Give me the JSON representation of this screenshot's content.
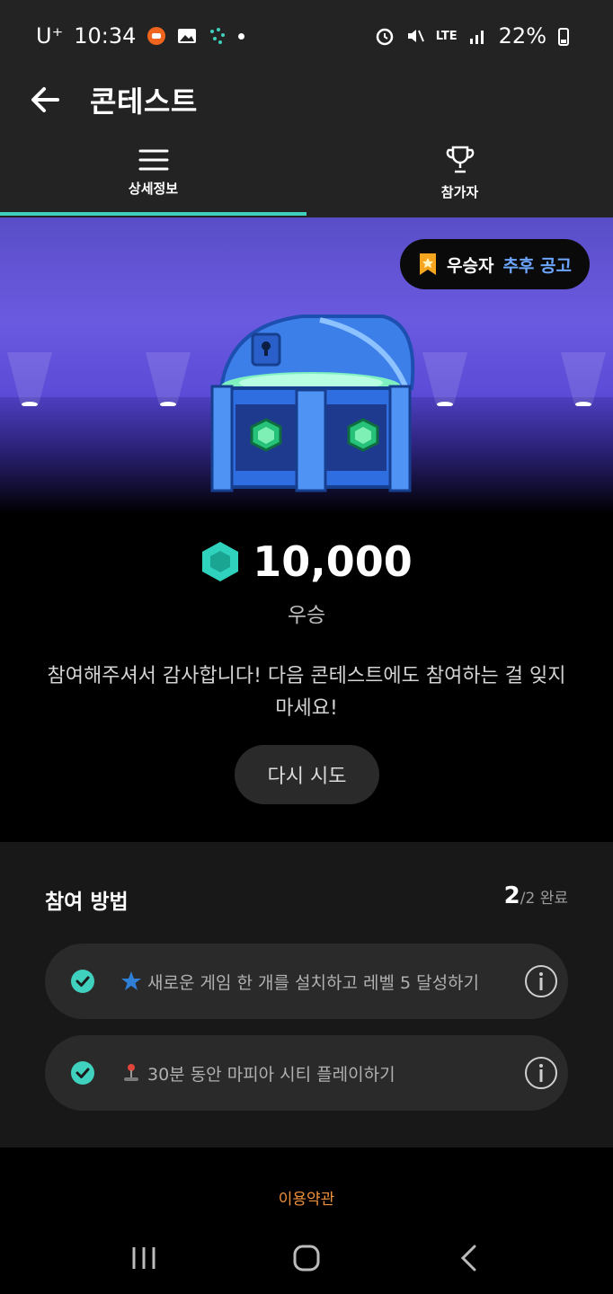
{
  "status_bar": {
    "carrier": "U⁺",
    "time": "10:34",
    "network": "LTE",
    "battery": "22%"
  },
  "header": {
    "title": "콘테스트",
    "back_icon": "arrow-left-icon"
  },
  "tabs": [
    {
      "label": "상세정보",
      "icon": "menu-icon",
      "active": true
    },
    {
      "label": "참가자",
      "icon": "trophy-icon",
      "active": false
    }
  ],
  "banner": {
    "winner_label": "우승자",
    "winner_status": "추후 공고",
    "image": "treasure-chest"
  },
  "prize": {
    "amount": "10,000",
    "caption": "우승",
    "currency_icon": "gem-icon"
  },
  "message": "참여해주셔서 감사합니다! 다음 콘테스트에도 참여하는 걸 잊지 마세요!",
  "retry_label": "다시 시도",
  "howto": {
    "title": "참여 방법",
    "completed": "2",
    "total_suffix": "/2 완료",
    "tasks": [
      {
        "icon": "star-icon",
        "text": "새로운 게임 한 개를 설치하고 레벨 5 달성하기",
        "done": true
      },
      {
        "icon": "joystick-icon",
        "text": "30분 동안 마피아 시티 플레이하기",
        "done": true
      }
    ]
  },
  "terms_label": "이용약관",
  "colors": {
    "accent": "#3fd1be",
    "terms": "#f0923c",
    "highlight": "#6da6ff",
    "banner": "#6a5ae0"
  }
}
